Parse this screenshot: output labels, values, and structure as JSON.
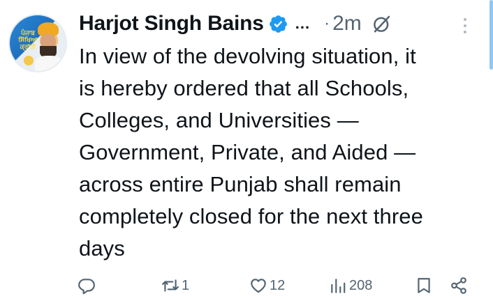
{
  "author": {
    "name": "Harjot Singh Bains",
    "avatar_text": "ਪੰਜਾਬ ਸਿੱਖਿਆ ਕ੍ਰਾਂਤੀ"
  },
  "meta": {
    "ellipsis": "...",
    "separator": "·",
    "time": "2m"
  },
  "tweet": {
    "text": "In view of the devolving situation, it\nis hereby ordered that all Schools,\nColleges, and Universities —\nGovernment, Private, and Aided —\nacross entire Punjab shall remain\ncompletely closed for the next three\ndays"
  },
  "actions": {
    "reply_count": "",
    "repost_count": "1",
    "like_count": "12",
    "views_count": "208"
  },
  "icons": [
    "verified-badge-icon",
    "grok-icon",
    "more-icon",
    "reply-icon",
    "repost-icon",
    "like-icon",
    "views-icon",
    "bookmark-icon",
    "share-icon"
  ],
  "colors": {
    "text": "#0f1419",
    "secondary": "#536471",
    "verified": "#1d9bf0",
    "scrollbar": "#8ec8f5"
  }
}
